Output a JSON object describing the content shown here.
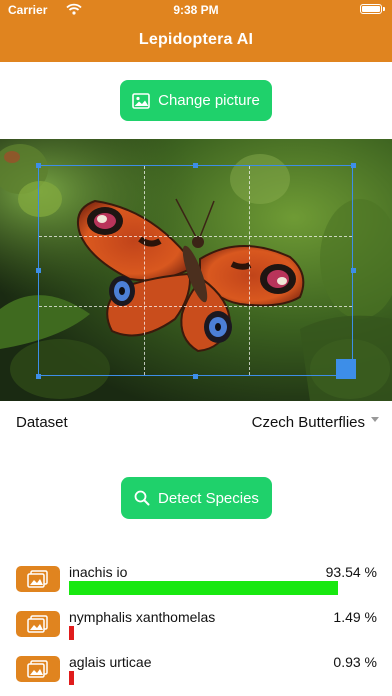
{
  "status_bar": {
    "carrier": "Carrier",
    "time": "9:38 PM"
  },
  "app": {
    "title": "Lepidoptera AI"
  },
  "change_picture": {
    "label": "Change picture",
    "icon": "image-icon"
  },
  "dataset": {
    "label": "Dataset",
    "selected": "Czech Butterflies"
  },
  "detect": {
    "label": "Detect Species",
    "icon": "search-icon"
  },
  "colors": {
    "accent": "#e0841f",
    "button": "#1fd16b",
    "crop": "#3d8ee8",
    "bar_high": "#18e810",
    "bar_low": "#e01c1c"
  },
  "results": [
    {
      "name": "inachis io",
      "percent_label": "93.54 %",
      "fraction": 0.9354
    },
    {
      "name": "nymphalis xanthomelas",
      "percent_label": "1.49 %",
      "fraction": 0.0149
    },
    {
      "name": "aglais urticae",
      "percent_label": "0.93 %",
      "fraction": 0.0093
    }
  ]
}
